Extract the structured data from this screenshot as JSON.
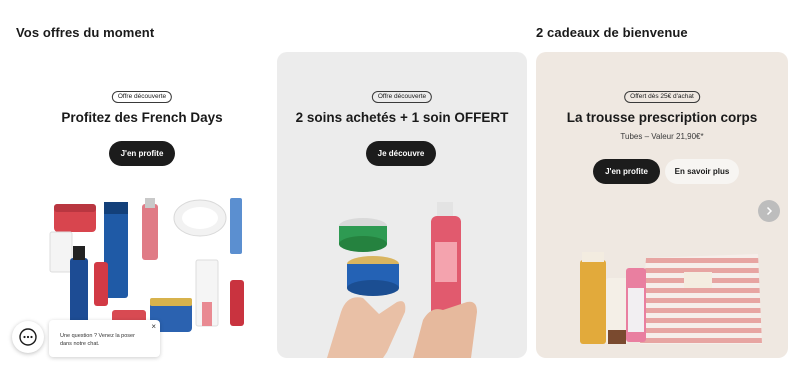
{
  "sections": {
    "offres_title": "Vos offres du moment",
    "cadeaux_title": "2 cadeaux de bienvenue"
  },
  "cards": [
    {
      "badge": "Offre découverte",
      "title": "Profitez des French Days",
      "button": "J'en profite",
      "image_alt": "Gamme de soins Dr Pierre Ricaud"
    },
    {
      "badge": "Offre découverte",
      "title": "2 soins achetés + 1 soin OFFERT",
      "button": "Je découvre",
      "image_alt": "Mains tenant des pots de crème et un flacon de lotion"
    },
    {
      "badge": "Offert dès 25€ d'achat",
      "title": "La trousse prescription corps",
      "subtitle": "Tubes – Valeur 21,90€*",
      "button_primary": "J'en profite",
      "button_secondary": "En savoir plus",
      "image_alt": "Trousse rayée et tubes de soins corps"
    }
  ],
  "chat": {
    "message": "Une question ? Venez la poser dans notre chat.",
    "close": "×"
  },
  "icons": {
    "next": "chevron-right-icon",
    "chat": "chat-bubble-icon"
  },
  "colors": {
    "button_dark": "#1c1c1c",
    "card_grey": "#ececec",
    "card_beige": "#efe8e1"
  }
}
